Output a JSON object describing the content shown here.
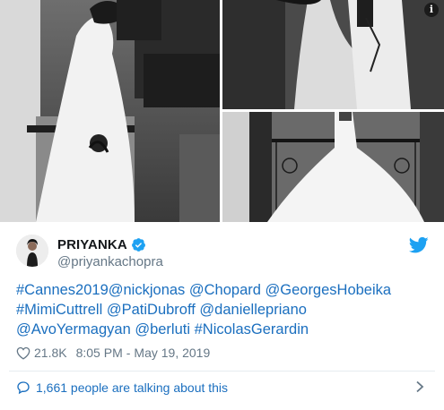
{
  "photos": [
    {
      "name": "photo-couple-terrace"
    },
    {
      "name": "photo-couple-embrace"
    },
    {
      "name": "photo-gown-balcony"
    }
  ],
  "info_label": "i",
  "author": {
    "name": "PRIYANKA",
    "handle": "@priyankachopra"
  },
  "tweet": {
    "lines": [
      "#Cannes2019@nickjonas @Chopard @GeorgesHobeika",
      "#MimiCuttrell @PatiDubroff @daniellepriano",
      "@AvoYermagyan @berluti #NicolasGerardin"
    ]
  },
  "meta": {
    "likes": "21.8K",
    "time": "8:05 PM",
    "separator": "-",
    "date": "May 19, 2019"
  },
  "footer": {
    "talking": "1,661 people are talking about this"
  },
  "colors": {
    "link": "#1b6fbf",
    "muted": "#657786",
    "twitter_blue": "#1da1f2",
    "verified": "#1da1f2"
  },
  "icons": [
    "info-icon",
    "verified-badge-icon",
    "twitter-bird-icon",
    "heart-icon",
    "speech-bubble-icon",
    "chevron-right-icon"
  ]
}
